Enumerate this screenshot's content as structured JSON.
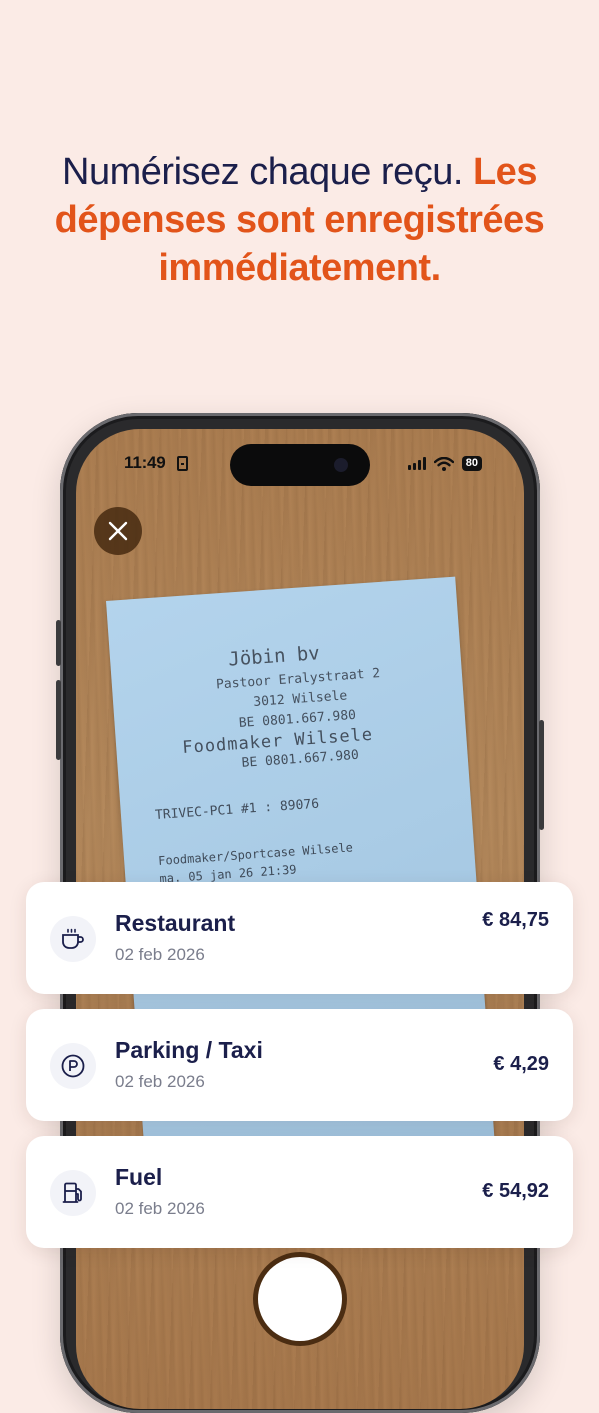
{
  "headline": {
    "dark": "Numérisez chaque reçu. ",
    "accent": "Les dépenses sont enregistrées immédiatement."
  },
  "status_bar": {
    "time": "11:49",
    "battery": "80"
  },
  "receipt": {
    "line1": "Jöbin bv",
    "line2": "Pastoor Eralystraat 2",
    "line3": "3012 Wilsele",
    "line4": "BE 0801.667.980",
    "line5": "Foodmaker Wilsele",
    "line6": "BE 0801.667.980",
    "line7": "TRIVEC-PC1 #1 : 89076",
    "line8": "Foodmaker/Sportcase Wilsele",
    "line9": "ma. 05 jan 26  21:39"
  },
  "expenses": [
    {
      "category": "Restaurant",
      "date": "02 feb 2026",
      "amount": "€ 84,75",
      "icon": "coffee-cup-icon"
    },
    {
      "category": "Parking / Taxi",
      "date": "02 feb 2026",
      "amount": "€ 4,29",
      "icon": "parking-icon"
    },
    {
      "category": "Fuel",
      "date": "02 feb 2026",
      "amount": "€ 54,92",
      "icon": "fuel-pump-icon"
    }
  ],
  "colors": {
    "background": "#fbebe6",
    "headline_dark": "#1b1f4b",
    "headline_accent": "#e2541a"
  }
}
